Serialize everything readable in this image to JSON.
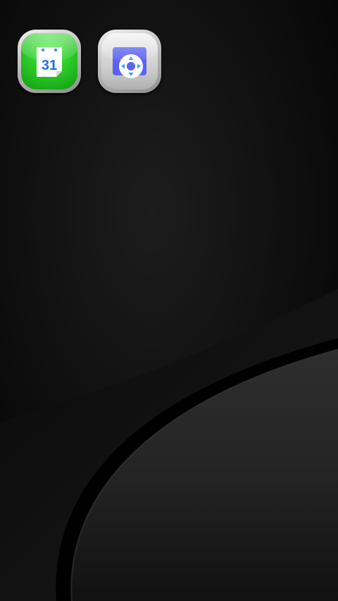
{
  "screen": {
    "type": "android-home-screen",
    "wallpaper": "dark-curves"
  },
  "apps": [
    {
      "name": "calendar",
      "icon": "calendar-icon",
      "date_label": "31",
      "accent": "#27c423"
    },
    {
      "name": "remote",
      "icon": "remote-control-icon",
      "accent": "#5a63f0"
    }
  ],
  "colors": {
    "background": "#050505",
    "curve_light": "#2c2c2c",
    "calendar_blue": "#1e6fe0",
    "remote_blue": "#5a63f0",
    "arrow_blue": "#3aa0ff"
  }
}
